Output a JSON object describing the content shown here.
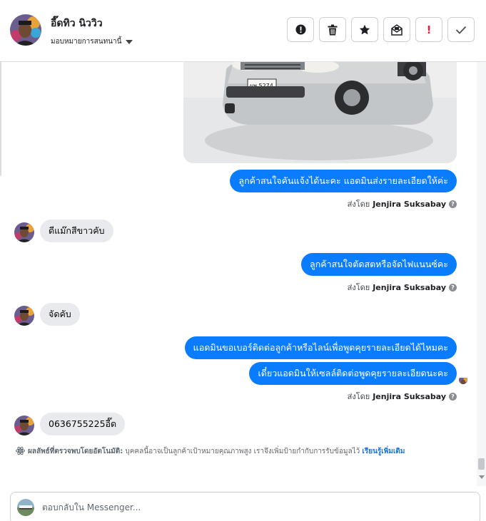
{
  "header": {
    "contact_name": "อี๊ดทิว นิววิว",
    "assign_label": "มอบหมายการสนทนานี้",
    "actions": [
      {
        "icon": "alert-circle-icon"
      },
      {
        "icon": "trash-icon"
      },
      {
        "icon": "star-icon"
      },
      {
        "icon": "mark-unread-icon"
      },
      {
        "icon": "spam-exclamation-icon",
        "glyph": "!"
      },
      {
        "icon": "check-icon"
      }
    ]
  },
  "messages": [
    {
      "side": "out",
      "text": "ลูกค้าสนใจคันแจ้งได้นะคะ แอดมินส่งรายละเอียดให้ค่ะ"
    },
    {
      "side": "in",
      "text": "ดีแม๊กสีขาวคับ"
    },
    {
      "side": "out",
      "text": "ลูกค้าสนใจตัดสตหรือจัดไฟแนนซ์คะ"
    },
    {
      "side": "in",
      "text": "จัดคับ"
    },
    {
      "side": "out",
      "text": "แอดมินขอเบอร์ติดต่อลูกค้าหรือไลน์เพื่อพูดคุยรายละเอียดได้ไหมคะ"
    },
    {
      "side": "out",
      "text": "เดี๋ยวแอดมินให้เซลล์ติดต่อพูดคุยรายละเอียดนะคะ"
    },
    {
      "side": "in",
      "text": "0636755225อี๊ด"
    }
  ],
  "sent_by": {
    "prefix": "ส่งโดย",
    "name": "Jenjira Suksabay",
    "info": "?"
  },
  "photo": {
    "plate": "ผพ 5274"
  },
  "auto_detect": {
    "lead": "ผลลัพธ์ที่ตรวจพบโดยอัตโนมัติ:",
    "body": "บุคคลนี้อาจเป็นลูกค้าเป้าหมายคุณภาพสูง เราจึงเพิ่มป้ายกำกับการรับข้อมูลไว้",
    "learn_more": "เรียนรู้เพิ่มเติม"
  },
  "composer": {
    "placeholder": "ตอบกลับใน Messenger..."
  },
  "colors": {
    "outgoing_bubble": "#0a7cff",
    "incoming_bubble": "#e9eaed",
    "link": "#1b74e4",
    "spam": "#e41e3f"
  }
}
